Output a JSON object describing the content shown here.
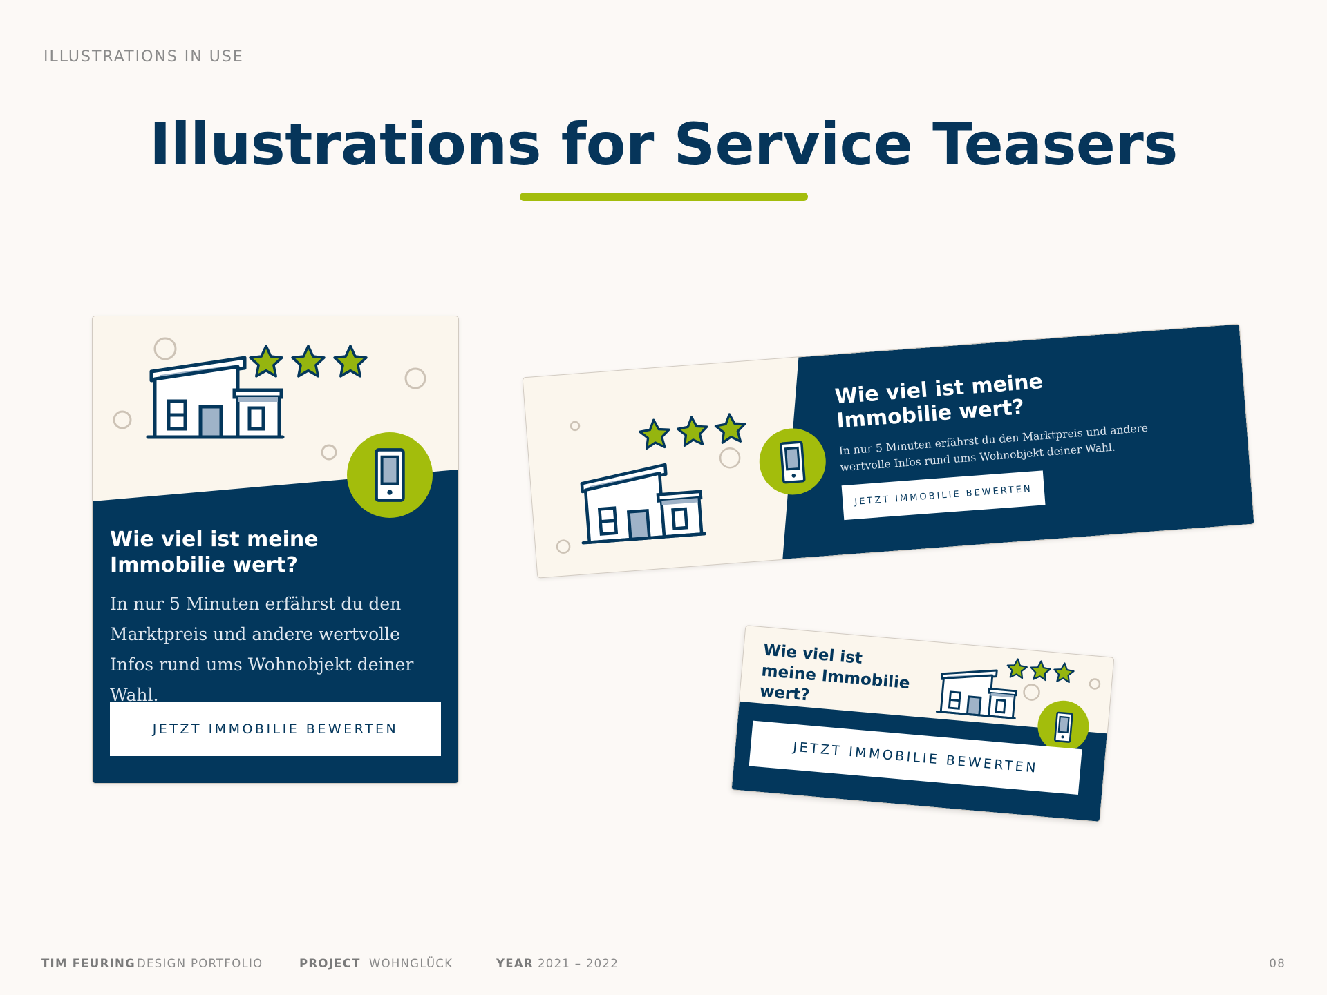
{
  "section_label": "ILLUSTRATIONS IN USE",
  "title": "Illustrations for Service Teasers",
  "colors": {
    "navy": "#03375c",
    "lime": "#a3bd0c",
    "cream": "#fbf6ed",
    "background": "#fcf9f6"
  },
  "icons": [
    "house-icon",
    "star-icon",
    "smartphone-icon",
    "circle-bubble-icon"
  ],
  "teaser_vertical": {
    "heading": "Wie viel ist meine Immobilie wert?",
    "text": "In nur 5 Minuten erfährst du den Marktpreis und andere wertvolle Infos rund ums Wohnobjekt deiner Wahl.",
    "button": "JETZT IMMOBILIE BEWERTEN",
    "stars": 3
  },
  "teaser_wide": {
    "heading": "Wie viel ist meine Immobilie wert?",
    "text": "In nur 5 Minuten erfährst du den Marktpreis und andere wertvolle Infos rund ums Wohnobjekt deiner Wahl.",
    "button": "JETZT IMMOBILIE BEWERTEN",
    "stars": 3
  },
  "teaser_small": {
    "heading": "Wie viel ist meine Immobilie wert?",
    "button": "JETZT IMMOBILIE BEWERTEN",
    "stars": 3
  },
  "footer": {
    "author_key": "TIM FEURING",
    "author_value": "DESIGN PORTFOLIO",
    "project_key": "PROJECT",
    "project_value": "WOHNGLÜCK",
    "year_key": "YEAR",
    "year_value": "2021 – 2022",
    "page_number": "08"
  }
}
